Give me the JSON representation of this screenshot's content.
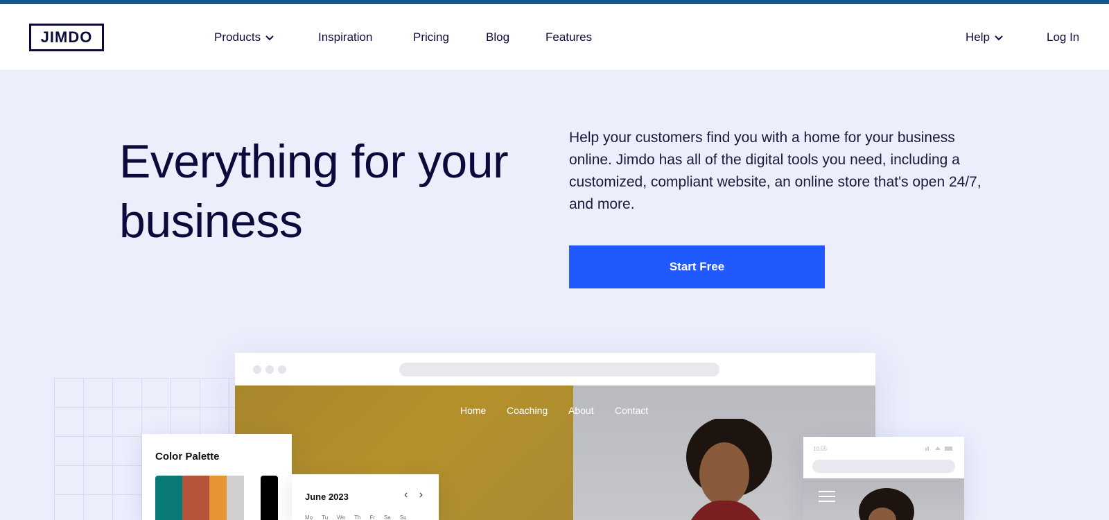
{
  "header": {
    "logo": "JIMDO",
    "nav": [
      {
        "label": "Products",
        "has_dropdown": true
      },
      {
        "label": "Inspiration",
        "has_dropdown": false
      },
      {
        "label": "Pricing",
        "has_dropdown": false
      },
      {
        "label": "Blog",
        "has_dropdown": false
      },
      {
        "label": "Features",
        "has_dropdown": false
      }
    ],
    "help": {
      "label": "Help",
      "has_dropdown": true
    },
    "login": "Log In"
  },
  "hero": {
    "title_line1": "Everything for your",
    "title_line2": "business",
    "description": "Help your customers find you with a home for your business online. Jimdo has all of the digital tools you need, including a customized, compliant website, an online store that's open 24/7, and more.",
    "cta": "Start Free"
  },
  "mockup": {
    "site_nav": [
      "Home",
      "Coaching",
      "About",
      "Contact"
    ],
    "palette": {
      "title": "Color Palette",
      "colors": [
        "#0a7a78",
        "#b4543a",
        "#e59533",
        "#cfcfcf",
        "#000000"
      ]
    },
    "calendar": {
      "title": "June 2023",
      "arrows": "‹ ›",
      "days": [
        "Mo",
        "Tu",
        "We",
        "Th",
        "Fr",
        "Sa",
        "Su"
      ]
    },
    "phone": {
      "time": "10:05"
    }
  },
  "colors": {
    "accent": "#2059fd",
    "text_dark": "#0b0b3b",
    "hero_bg": "#eceefc",
    "top_stripe": "#11568f"
  }
}
